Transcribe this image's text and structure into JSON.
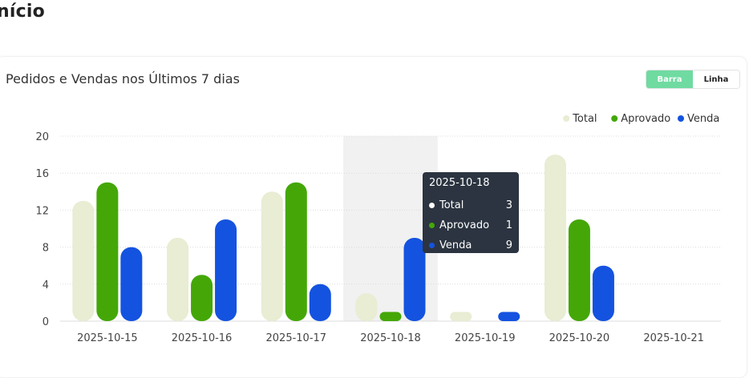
{
  "page": {
    "title": "nício"
  },
  "card": {
    "title": "Pedidos e Vendas nos Últimos 7 dias",
    "toggle": {
      "bar_label": "Barra",
      "line_label": "Linha",
      "selected": "Barra"
    }
  },
  "colors": {
    "total": "#e8edd3",
    "aprovado": "#44a707",
    "venda": "#1453e0",
    "accent": "#6fdba1"
  },
  "tooltip": {
    "title": "2025-10-18",
    "rows": [
      {
        "label": "Total",
        "value": "3"
      },
      {
        "label": "Aprovado",
        "value": "1"
      },
      {
        "label": "Venda",
        "value": "9"
      }
    ]
  },
  "chart_data": {
    "type": "bar",
    "title": "Pedidos e Vendas nos Últimos 7 dias",
    "categories": [
      "2025-10-15",
      "2025-10-16",
      "2025-10-17",
      "2025-10-18",
      "2025-10-19",
      "2025-10-20",
      "2025-10-21"
    ],
    "series": [
      {
        "name": "Total",
        "values": [
          13,
          9,
          14,
          3,
          1,
          18,
          0
        ]
      },
      {
        "name": "Aprovado",
        "values": [
          15,
          5,
          15,
          1,
          0,
          11,
          0
        ]
      },
      {
        "name": "Venda",
        "values": [
          8,
          11,
          4,
          9,
          1,
          6,
          0
        ]
      }
    ],
    "ylim": [
      0,
      20
    ],
    "yticks": [
      0,
      4,
      8,
      12,
      16,
      20
    ],
    "legend": "top-right",
    "grid": true,
    "highlighted_category": "2025-10-18"
  }
}
